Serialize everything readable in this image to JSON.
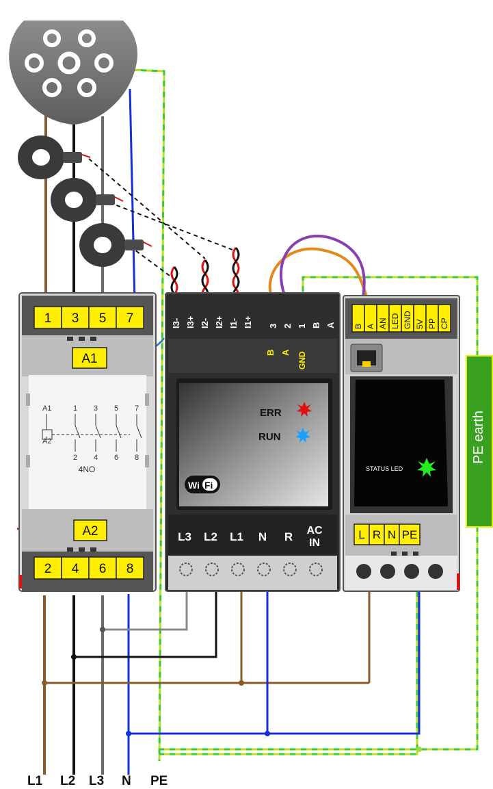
{
  "contactor": {
    "top_terminals": [
      "1",
      "3",
      "5",
      "7"
    ],
    "bottom_terminals": [
      "2",
      "4",
      "6",
      "8"
    ],
    "coil_top": "A1",
    "coil_bottom": "A2",
    "schematic": {
      "coil_a1": "A1",
      "coil_a2": "A2",
      "contacts_top": [
        "1",
        "3",
        "5",
        "7"
      ],
      "contacts_bottom": [
        "2",
        "4",
        "6",
        "8"
      ],
      "type": "4NO"
    }
  },
  "meter": {
    "ct_terminals": [
      "I3-",
      "I3+",
      "I2-",
      "I2+",
      "I1-",
      "I1+"
    ],
    "io_terminals": [
      "3",
      "2",
      "1",
      "B",
      "A"
    ],
    "sub_b": "B",
    "sub_a": "A",
    "sub_gnd": "GND",
    "led_err": "ERR",
    "led_run": "RUN",
    "wifi_left": "Wi",
    "wifi_right": "Fi",
    "bottom_terminals": [
      "L3",
      "L2",
      "L1",
      "N",
      "R",
      "AC\nIN"
    ],
    "ac_in_line1": "AC",
    "ac_in_line2": "IN"
  },
  "controller": {
    "top_terminals": [
      "B",
      "A",
      "AN",
      "LED",
      "GND",
      "5V",
      "PP",
      "CP"
    ],
    "status_led": "STATUS LED",
    "bottom_terminals": [
      "L",
      "R",
      "N",
      "PE"
    ]
  },
  "pe_earth_label": "PE earth",
  "supply_labels": [
    "L1",
    "L2",
    "L3",
    "N",
    "PE"
  ],
  "colors": {
    "brown": "#8b5a2b",
    "black": "#111111",
    "grey": "#6b6b6b",
    "blue": "#1530d8",
    "green_yellow": "#9be03a",
    "orange": "#e08a1e",
    "purple": "#8a3fb0",
    "terminal_yellow": "#ffee00",
    "led_red": "#e01010",
    "led_blue": "#1aa0ff",
    "led_green": "#22ee22"
  }
}
